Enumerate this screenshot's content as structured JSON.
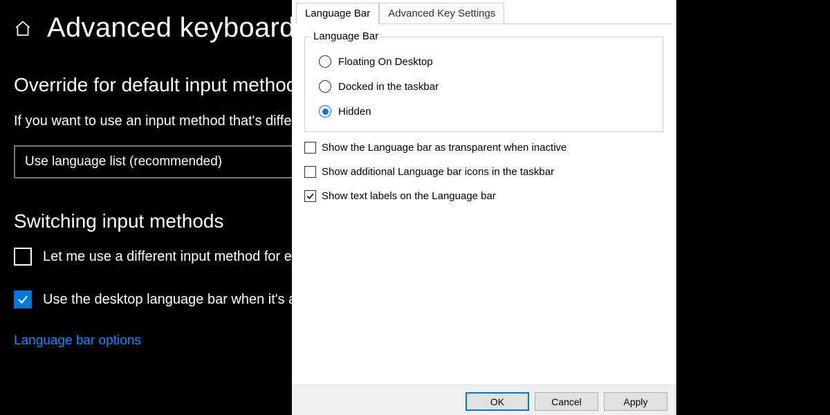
{
  "settings": {
    "page_title": "Advanced keyboard",
    "section_override": {
      "title": "Override for default input method",
      "body": "If you want to use an input method that's different than the first one in your language list, choose it here",
      "dropdown_value": "Use language list (recommended)"
    },
    "section_switching": {
      "title": "Switching input methods",
      "checkbox_different_input": {
        "label": "Let me use a different input method for each app window",
        "checked": false
      },
      "checkbox_desktop_langbar": {
        "label": "Use the desktop language bar when it's available",
        "checked": true
      }
    },
    "link_langbar_options": "Language bar options"
  },
  "dialog": {
    "tabs": [
      {
        "label": "Language Bar",
        "active": true
      },
      {
        "label": "Advanced Key Settings",
        "active": false
      }
    ],
    "group": {
      "title": "Language Bar",
      "radios": [
        {
          "label": "Floating On Desktop",
          "selected": false
        },
        {
          "label": "Docked in the taskbar",
          "selected": false
        },
        {
          "label": "Hidden",
          "selected": true
        }
      ]
    },
    "checkboxes": [
      {
        "label": "Show the Language bar as transparent when inactive",
        "checked": false
      },
      {
        "label": "Show additional Language bar icons in the taskbar",
        "checked": false
      },
      {
        "label": "Show text labels on the Language bar",
        "checked": true
      }
    ],
    "buttons": {
      "ok": "OK",
      "cancel": "Cancel",
      "apply": "Apply"
    }
  }
}
